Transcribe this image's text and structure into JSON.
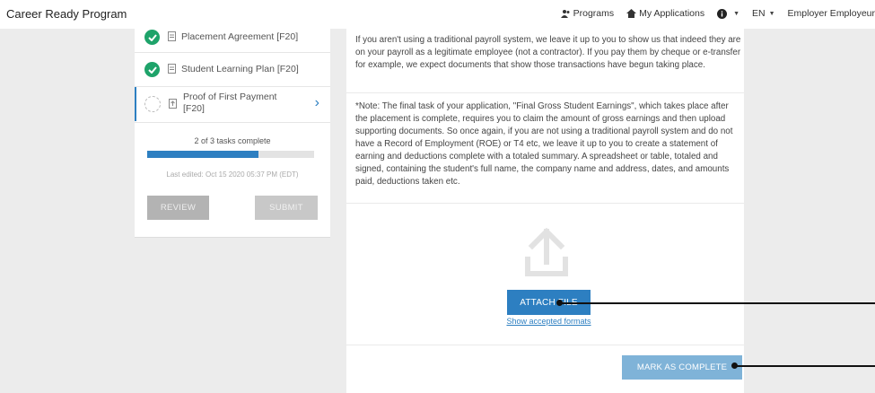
{
  "app": {
    "title": "Career Ready Program"
  },
  "topnav": {
    "programs": "Programs",
    "my_applications": "My Applications",
    "language": "EN",
    "user": "Employer Employeur"
  },
  "tasks": [
    {
      "label": "Placement Agreement [F20]",
      "status": "complete"
    },
    {
      "label": "Student Learning Plan [F20]",
      "status": "complete"
    },
    {
      "label": "Proof of First Payment [F20]",
      "status": "active"
    }
  ],
  "progress": {
    "text": "2 of 3 tasks complete",
    "fraction": 0.667,
    "last_edited": "Last edited: Oct 15 2020 05:37 PM (EDT)"
  },
  "actions": {
    "review": "REVIEW",
    "submit": "SUBMIT"
  },
  "content": {
    "paragraph1": "If you aren't using a traditional payroll system, we leave it up to you to show us that indeed they are on your payroll as a legitimate employee (not a contractor). If you pay them by cheque or e-transfer for example, we expect documents that show those transactions have begun taking place.",
    "paragraph2": "*Note: The final task of your application, \"Final Gross Student Earnings\", which takes place after the placement is complete, requires you to claim the amount of gross earnings and then upload supporting documents.  So once again, if you are not using a traditional payroll system and do not have a Record of Employment (ROE) or T4 etc, we leave it up to you to create a statement of earning and deductions complete with a totaled summary.  A spreadsheet or table, totaled and signed, containing the student's full name, the company name and address, dates, and amounts paid, deductions taken etc."
  },
  "upload": {
    "attach_label": "ATTACH FILE",
    "formats_link": "Show accepted formats",
    "mark_complete_label": "MARK AS COMPLETE"
  },
  "colors": {
    "accent": "#2d7fc1",
    "success": "#1ea36a",
    "muted_button": "#b3b3b3"
  }
}
